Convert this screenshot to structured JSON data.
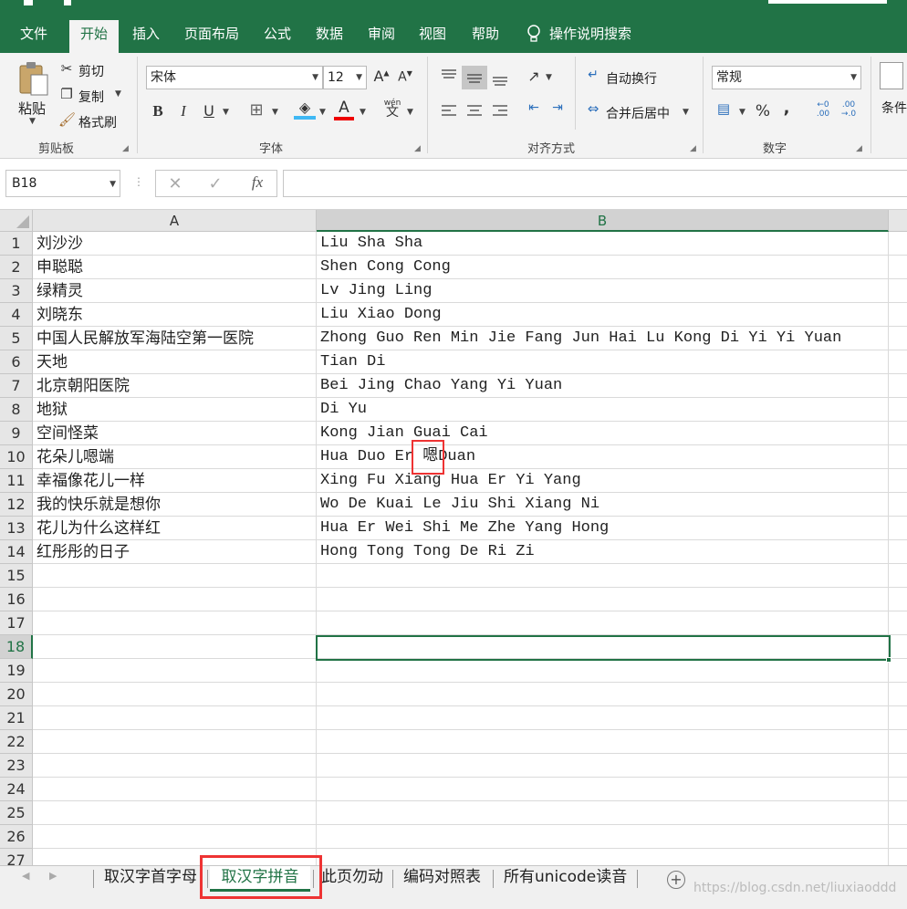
{
  "ribbon_tabs": [
    "文件",
    "开始",
    "插入",
    "页面布局",
    "公式",
    "数据",
    "审阅",
    "视图",
    "帮助"
  ],
  "tell_me": "操作说明搜索",
  "clipboard": {
    "paste": "粘贴",
    "cut": "剪切",
    "copy": "复制",
    "format_painter": "格式刷",
    "group": "剪贴板"
  },
  "font": {
    "name": "宋体",
    "size": "12",
    "bold": "B",
    "italic": "I",
    "underline": "U",
    "font_color": "A",
    "phonetic": "wén",
    "phonetic_char": "文",
    "group": "字体"
  },
  "alignment": {
    "wrap": "自动换行",
    "merge": "合并后居中",
    "group": "对齐方式"
  },
  "number": {
    "format": "常规",
    "percent": "%",
    "comma": ",",
    "group": "数字"
  },
  "styles": {
    "conditional": "条件"
  },
  "formula_bar": {
    "name_box": "B18",
    "fx": "fx",
    "value": ""
  },
  "columns": [
    "A",
    "B"
  ],
  "rows": [
    {
      "n": "1",
      "a": "刘沙沙",
      "b": "Liu Sha Sha"
    },
    {
      "n": "2",
      "a": "申聪聪",
      "b": "Shen Cong Cong"
    },
    {
      "n": "3",
      "a": "绿精灵",
      "b": "Lv Jing Ling"
    },
    {
      "n": "4",
      "a": "刘晓东",
      "b": "Liu Xiao Dong"
    },
    {
      "n": "5",
      "a": "中国人民解放军海陆空第一医院",
      "b": "Zhong Guo Ren Min Jie Fang Jun Hai Lu Kong Di Yi Yi Yuan"
    },
    {
      "n": "6",
      "a": "天地",
      "b": "Tian Di"
    },
    {
      "n": "7",
      "a": "北京朝阳医院",
      "b": "Bei Jing Chao Yang Yi Yuan"
    },
    {
      "n": "8",
      "a": "地狱",
      "b": "Di Yu"
    },
    {
      "n": "9",
      "a": "空间怪菜",
      "b": "Kong Jian Guai Cai"
    },
    {
      "n": "10",
      "a": "花朵儿嗯端",
      "b": "Hua Duo Er 嗯Duan"
    },
    {
      "n": "11",
      "a": "幸福像花儿一样",
      "b": "Xing Fu Xiang Hua Er Yi Yang"
    },
    {
      "n": "12",
      "a": "我的快乐就是想你",
      "b": "Wo De Kuai Le Jiu Shi Xiang Ni"
    },
    {
      "n": "13",
      "a": "花儿为什么这样红",
      "b": "Hua Er Wei Shi Me Zhe Yang Hong"
    },
    {
      "n": "14",
      "a": "红彤彤的日子",
      "b": "Hong Tong Tong De Ri Zi"
    },
    {
      "n": "15",
      "a": "",
      "b": ""
    },
    {
      "n": "16",
      "a": "",
      "b": ""
    },
    {
      "n": "17",
      "a": "",
      "b": ""
    },
    {
      "n": "18",
      "a": "",
      "b": ""
    },
    {
      "n": "19",
      "a": "",
      "b": ""
    },
    {
      "n": "20",
      "a": "",
      "b": ""
    },
    {
      "n": "21",
      "a": "",
      "b": ""
    },
    {
      "n": "22",
      "a": "",
      "b": ""
    },
    {
      "n": "23",
      "a": "",
      "b": ""
    },
    {
      "n": "24",
      "a": "",
      "b": ""
    },
    {
      "n": "25",
      "a": "",
      "b": ""
    },
    {
      "n": "26",
      "a": "",
      "b": ""
    },
    {
      "n": "27",
      "a": "",
      "b": ""
    }
  ],
  "selected_row": "18",
  "sheet_tabs": [
    "取汉字首字母",
    "取汉字拼音",
    "此页勿动",
    "编码对照表",
    "所有unicode读音"
  ],
  "active_sheet": "取汉字拼音",
  "watermark": "https://blog.csdn.net/liuxiaoddd",
  "colors": {
    "accent": "#217346",
    "highlight": "#e33333"
  }
}
